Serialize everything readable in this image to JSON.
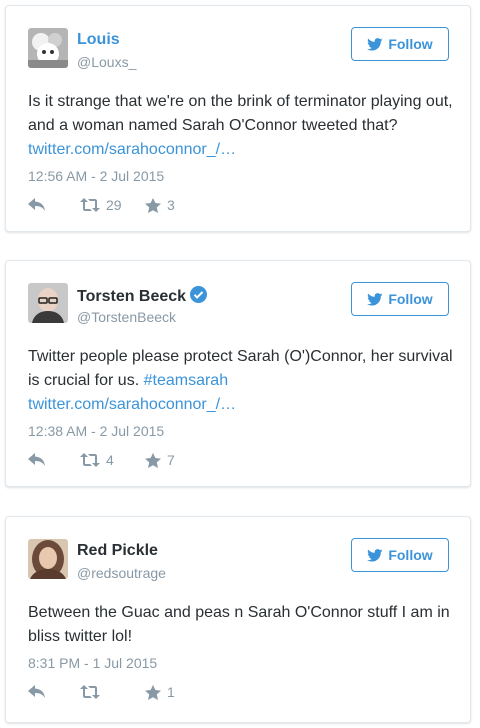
{
  "follow_label": "Follow",
  "tweets": [
    {
      "name": "Louis",
      "handle": "@Louxs_",
      "text": "Is it strange that we're on the brink of terminator playing out, and a woman named Sarah O'Connor tweeted that?",
      "link": "twitter.com/sarahoconnor_/…",
      "timestamp": "12:56 AM - 2 Jul 2015",
      "retweets": "29",
      "favorites": "3"
    },
    {
      "name": "Torsten Beeck",
      "handle": "@TorstenBeeck",
      "text": "Twitter people please protect Sarah (O')Connor, her survival is crucial for us.",
      "hashtag": "#teamsarah",
      "link": "twitter.com/sarahoconnor_/…",
      "timestamp": "12:38 AM - 2 Jul 2015",
      "retweets": "4",
      "favorites": "7"
    },
    {
      "name": "Red Pickle",
      "handle": "@redsoutrage",
      "text": "Between the Guac and peas n Sarah O'Connor stuff I am in bliss twitter lol!",
      "timestamp": "8:31 PM - 1 Jul 2015",
      "retweets": "",
      "favorites": "1"
    }
  ],
  "colors": {
    "link": "#3b94d9",
    "muted": "#8899a6",
    "text": "#292f33",
    "border": "#e1e8ed"
  },
  "icons": [
    "bird-icon",
    "verified-icon",
    "reply-icon",
    "retweet-icon",
    "star-icon"
  ]
}
